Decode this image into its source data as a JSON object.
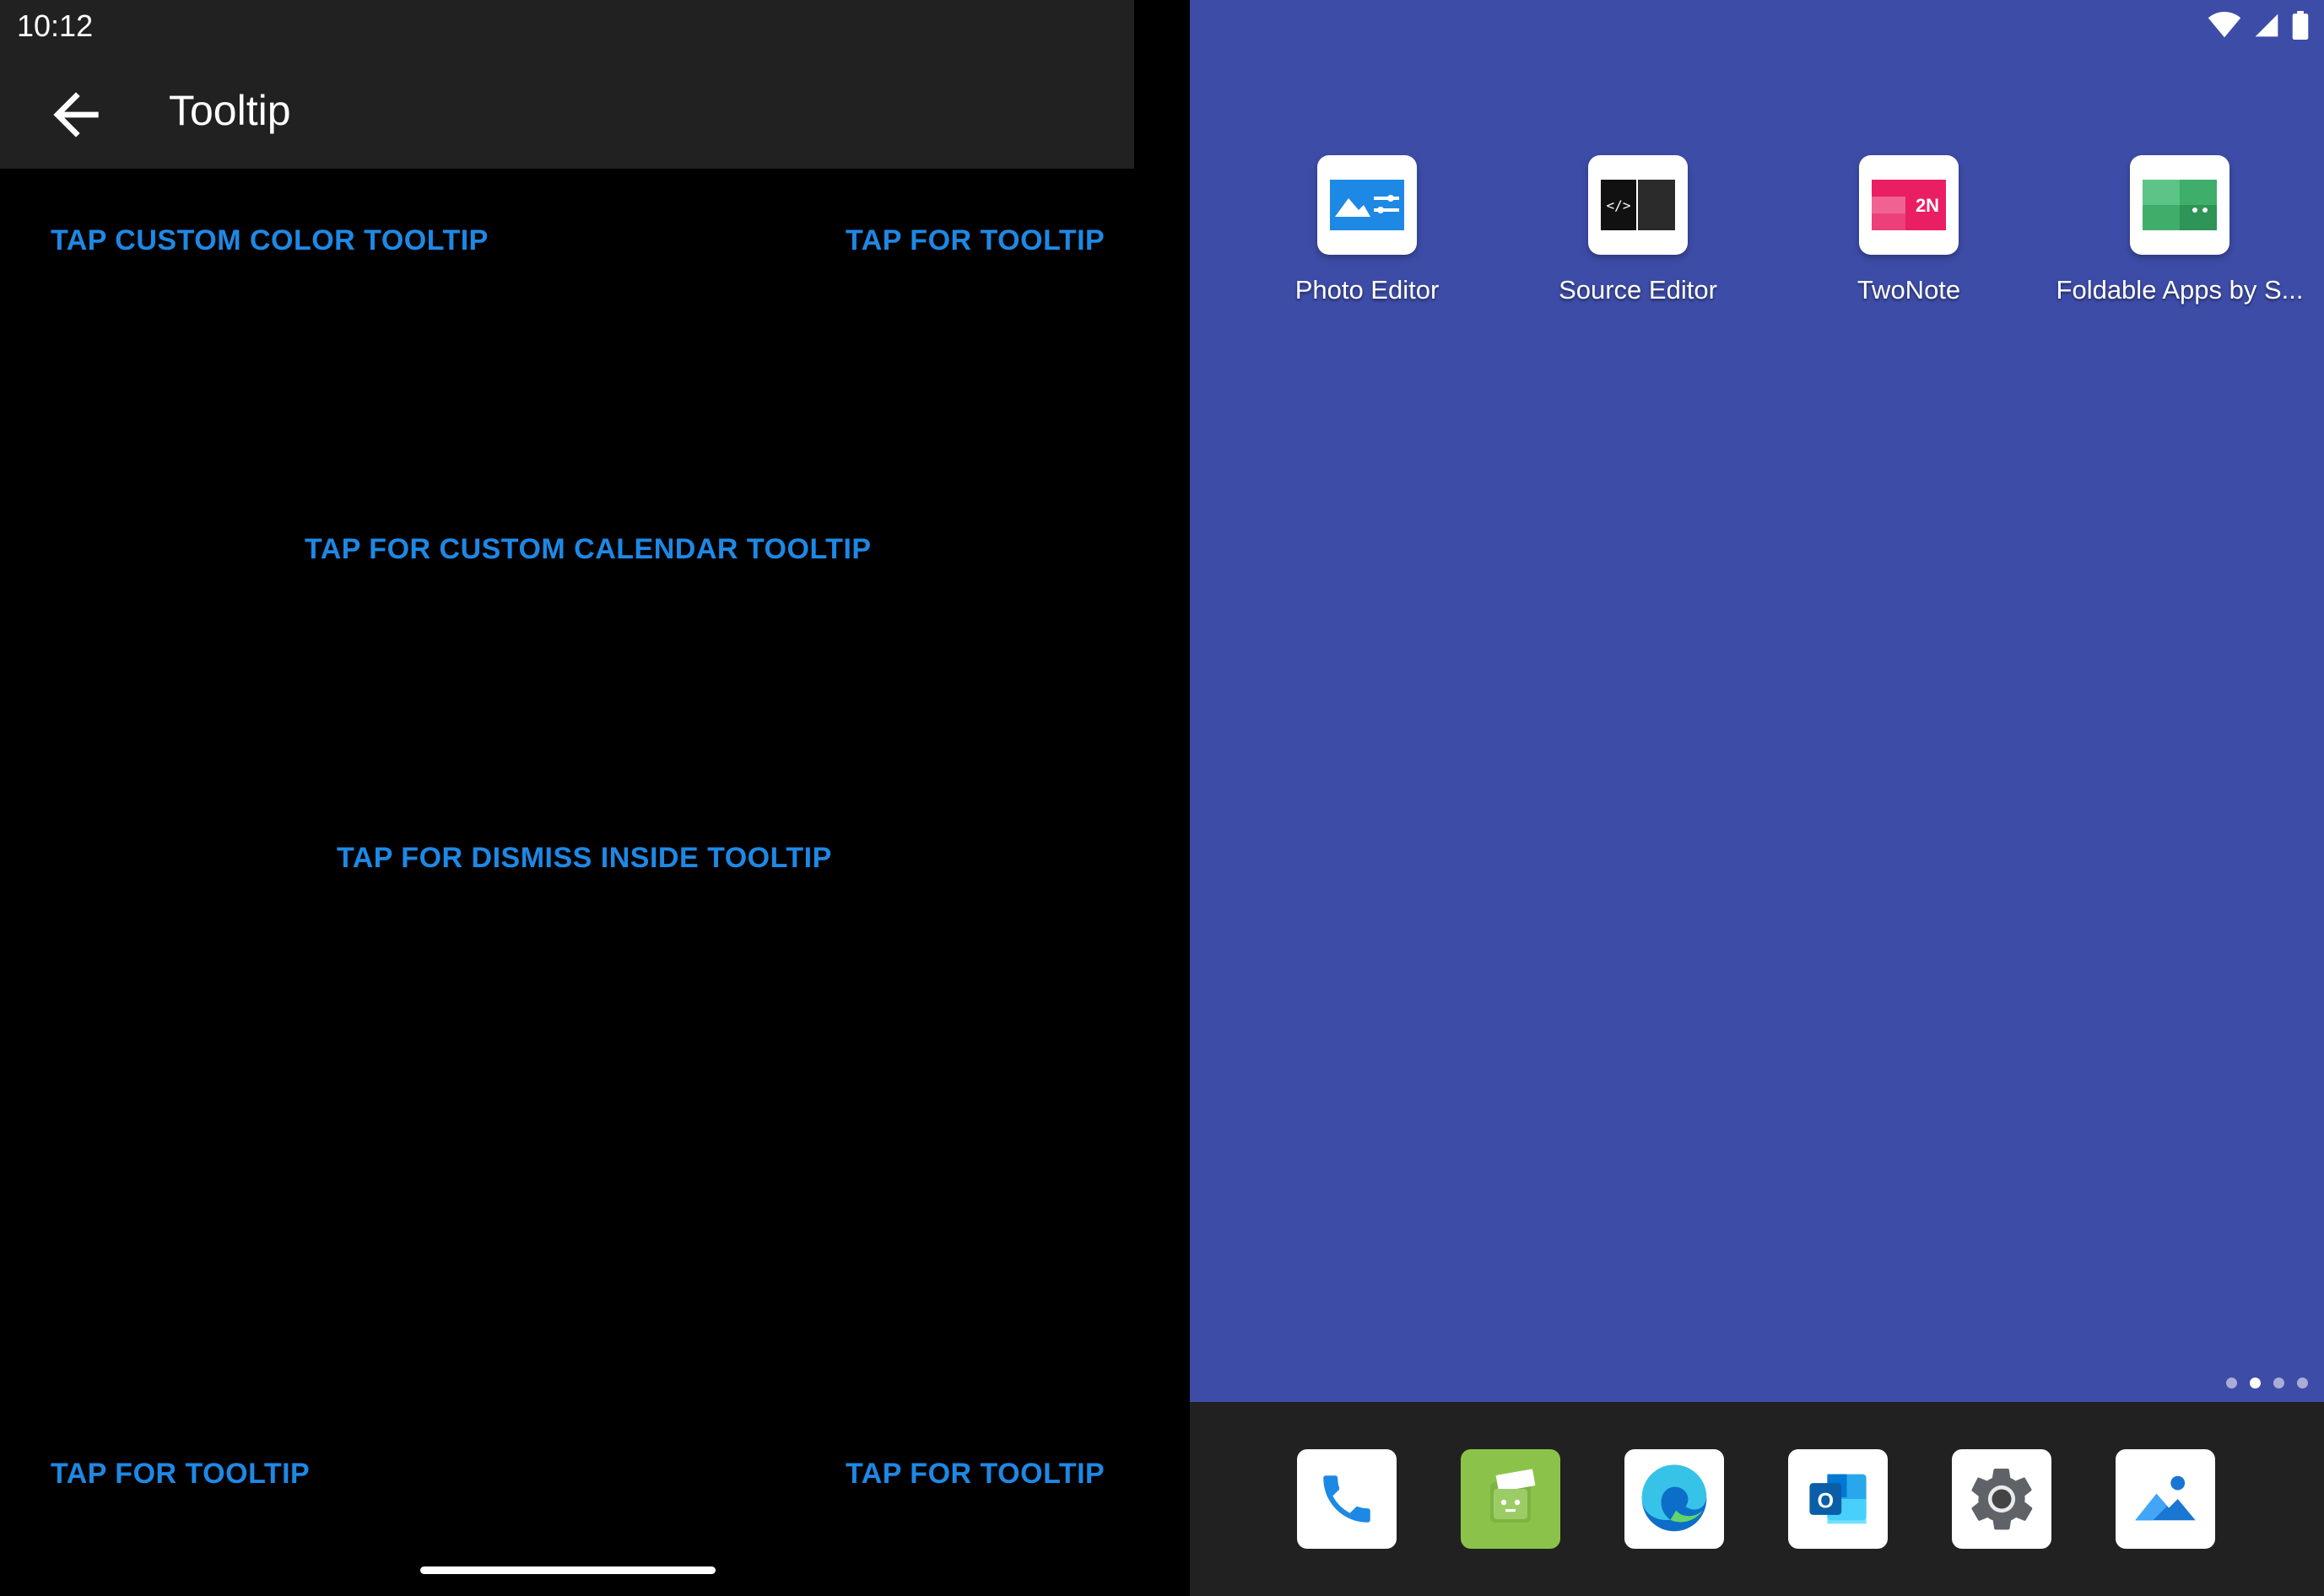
{
  "status_bar": {
    "time": "10:12"
  },
  "left_app": {
    "title": "Tooltip",
    "buttons": {
      "custom_color": "TAP CUSTOM COLOR TOOLTIP",
      "top_right": "TAP FOR TOOLTIP",
      "calendar": "TAP FOR CUSTOM CALENDAR TOOLTIP",
      "dismiss_inside": "TAP FOR DISMISS INSIDE TOOLTIP",
      "bottom_left": "TAP FOR TOOLTIP",
      "bottom_right": "TAP FOR TOOLTIP"
    }
  },
  "launcher": {
    "apps": [
      {
        "label": "Photo Editor",
        "icon": "photo-editor-icon"
      },
      {
        "label": "Source Editor",
        "icon": "source-editor-icon"
      },
      {
        "label": "TwoNote",
        "icon": "twonote-icon",
        "badge": "2N"
      },
      {
        "label": "Foldable Apps by S...",
        "icon": "foldable-apps-icon"
      }
    ],
    "page_indicator": {
      "pages": 4,
      "current": 2
    },
    "dock": [
      "phone-icon",
      "messages-icon",
      "edge-browser-icon",
      "outlook-icon",
      "settings-icon",
      "photos-icon"
    ]
  },
  "colors": {
    "accent_text": "#1e88e5",
    "wallpaper": "#3d4ca7",
    "bar": "#212121"
  }
}
